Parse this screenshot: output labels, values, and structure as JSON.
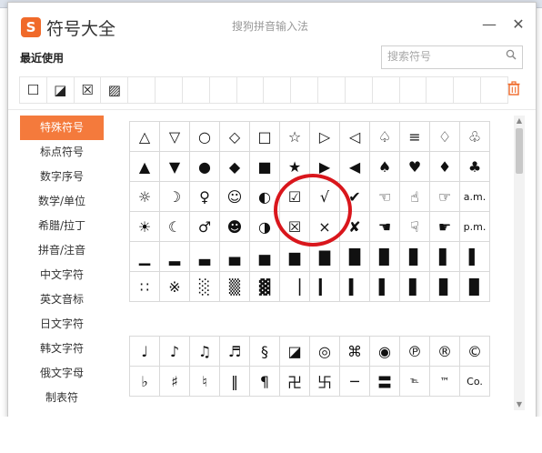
{
  "window": {
    "title": "符号大全",
    "subtitle": "搜狗拼音输入法",
    "logo": "S",
    "minimize": "—",
    "close": "✕"
  },
  "recent": {
    "label": "最近使用",
    "items": [
      "☐",
      "◪",
      "☒",
      "▨"
    ]
  },
  "search": {
    "placeholder": "搜索符号"
  },
  "sidebar": {
    "items": [
      {
        "label": "特殊符号"
      },
      {
        "label": "标点符号"
      },
      {
        "label": "数字序号"
      },
      {
        "label": "数学/单位"
      },
      {
        "label": "希腊/拉丁"
      },
      {
        "label": "拼音/注音"
      },
      {
        "label": "中文字符"
      },
      {
        "label": "英文音标"
      },
      {
        "label": "日文字符"
      },
      {
        "label": "韩文字符"
      },
      {
        "label": "俄文字母"
      },
      {
        "label": "制表符"
      }
    ]
  },
  "symbols_top": [
    [
      "△",
      "▽",
      "○",
      "◇",
      "□",
      "☆",
      "▷",
      "◁",
      "♤",
      "≡",
      "♢",
      "♧"
    ],
    [
      "▲",
      "▼",
      "●",
      "◆",
      "■",
      "★",
      "▶",
      "◀",
      "♠",
      "♥",
      "♦",
      "♣"
    ],
    [
      "☼",
      "☽",
      "♀",
      "☺",
      "◐",
      "☑",
      "√",
      "✔",
      "☜",
      "☝",
      "☞",
      "a.m."
    ],
    [
      "☀",
      "☾",
      "♂",
      "☻",
      "◑",
      "☒",
      "×",
      "✘",
      "☚",
      "☟",
      "☛",
      "p.m."
    ],
    [
      "▁",
      "▂",
      "▃",
      "▄",
      "▅",
      "▆",
      "▇",
      "█",
      "▉",
      "▊",
      "▋",
      "▌"
    ],
    [
      "∷",
      "※",
      "░",
      "▒",
      "▓",
      "▕",
      "▎",
      "▍",
      "▌",
      "▋",
      "▊",
      "▉"
    ]
  ],
  "symbols_bottom": [
    [
      "♩",
      "♪",
      "♫",
      "♬",
      "§",
      "◪",
      "◎",
      "⌘",
      "◉",
      "℗",
      "®",
      "©"
    ],
    [
      "♭",
      "♯",
      "♮",
      "‖",
      "¶",
      "卍",
      "卐",
      "─",
      "〓",
      "℡",
      "™",
      "Co."
    ]
  ],
  "colors": {
    "accent": "#f47a3c",
    "highlight_circle": "#d9161c"
  }
}
